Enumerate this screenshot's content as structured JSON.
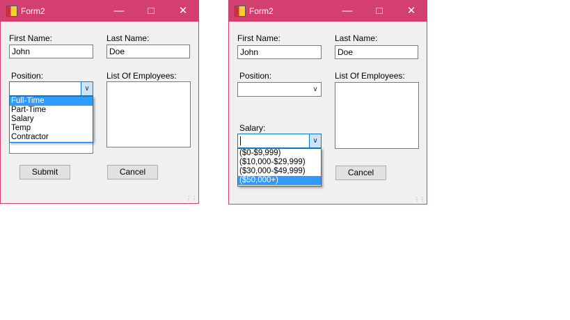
{
  "windows": [
    {
      "title": "Form2",
      "first_name_label": "First Name:",
      "first_name_value": "John",
      "last_name_label": "Last Name:",
      "last_name_value": "Doe",
      "position_label": "Position:",
      "employees_label": "List Of Employees:",
      "position_options": [
        "Full-Time",
        "Part-Time",
        "Salary",
        "Temp",
        "Contractor"
      ],
      "position_selected": "Full-Time",
      "submit": "Submit",
      "cancel": "Cancel"
    },
    {
      "title": "Form2",
      "first_name_label": "First Name:",
      "first_name_value": "John",
      "last_name_label": "Last Name:",
      "last_name_value": "Doe",
      "position_label": "Position:",
      "employees_label": "List Of Employees:",
      "salary_label": "Salary:",
      "salary_options": [
        "($0-$9,999)",
        "($10,000-$29,999)",
        "($30,000-$49,999)",
        "($50,000+)"
      ],
      "salary_selected": "($50,000+)",
      "cancel": "Cancel"
    }
  ],
  "colors": {
    "titlebar": "#d33f6e",
    "selection": "#3399ff"
  }
}
